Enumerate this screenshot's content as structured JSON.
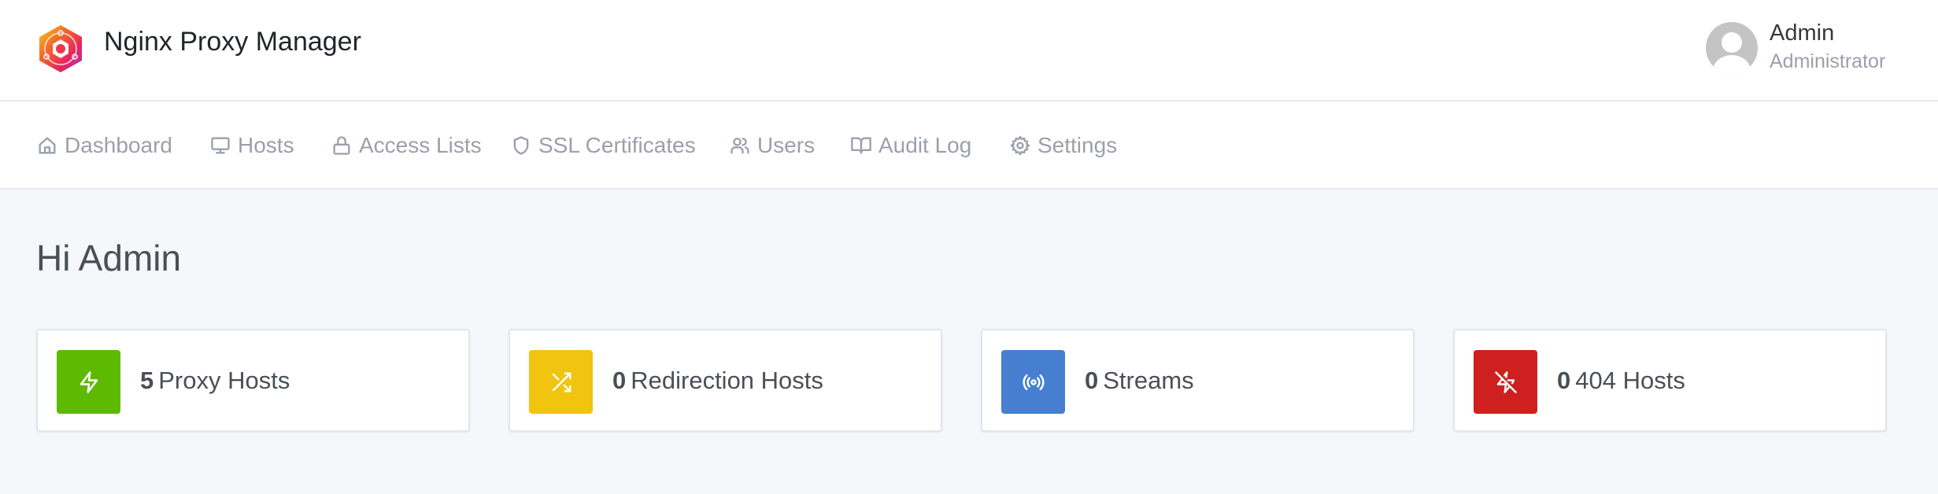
{
  "app": {
    "title": "Nginx Proxy Manager",
    "logo_icon": "nginx-proxy-manager-logo"
  },
  "user": {
    "name": "Admin",
    "role": "Administrator",
    "avatar_icon": "user-avatar-placeholder"
  },
  "nav": {
    "items": [
      {
        "label": "Dashboard",
        "icon": "home-icon"
      },
      {
        "label": "Hosts",
        "icon": "monitor-icon"
      },
      {
        "label": "Access Lists",
        "icon": "lock-icon"
      },
      {
        "label": "SSL Certificates",
        "icon": "shield-icon"
      },
      {
        "label": "Users",
        "icon": "users-icon"
      },
      {
        "label": "Audit Log",
        "icon": "book-open-icon"
      },
      {
        "label": "Settings",
        "icon": "gear-icon"
      }
    ]
  },
  "main": {
    "greeting": "Hi Admin",
    "stats": [
      {
        "count": "5",
        "label": "Proxy Hosts",
        "icon": "zap-icon",
        "color": "#5eba00"
      },
      {
        "count": "0",
        "label": "Redirection Hosts",
        "icon": "shuffle-icon",
        "color": "#f1c40f"
      },
      {
        "count": "0",
        "label": "Streams",
        "icon": "radio-icon",
        "color": "#467fcf"
      },
      {
        "count": "0",
        "label": "404 Hosts",
        "icon": "zap-off-icon",
        "color": "#cd201f"
      }
    ]
  }
}
